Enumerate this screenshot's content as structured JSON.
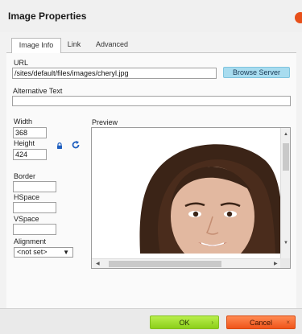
{
  "dialog": {
    "title": "Image Properties"
  },
  "tabs": [
    {
      "label": "Image Info",
      "active": true
    },
    {
      "label": "Link",
      "active": false
    },
    {
      "label": "Advanced",
      "active": false
    }
  ],
  "url": {
    "label": "URL",
    "value": "/sites/default/files/images/cheryl.jpg",
    "browse_label": "Browse Server"
  },
  "alt": {
    "label": "Alternative Text",
    "value": ""
  },
  "width": {
    "label": "Width",
    "value": "368"
  },
  "height": {
    "label": "Height",
    "value": "424"
  },
  "border": {
    "label": "Border",
    "value": ""
  },
  "hspace": {
    "label": "HSpace",
    "value": ""
  },
  "vspace": {
    "label": "VSpace",
    "value": ""
  },
  "alignment": {
    "label": "Alignment",
    "selected": "<not set>"
  },
  "preview": {
    "label": "Preview"
  },
  "footer": {
    "ok_label": "OK",
    "cancel_label": "Cancel"
  },
  "icons": {
    "close": "close-icon",
    "lock": "lock-icon",
    "reset": "reset-size-icon",
    "dropdown": "chevron-down-icon"
  },
  "colors": {
    "ok": "#8ccf1a",
    "cancel": "#f0541a",
    "browse": "#a8dcef",
    "close": "#e8501a",
    "link_icons": "#1f5fbf"
  }
}
